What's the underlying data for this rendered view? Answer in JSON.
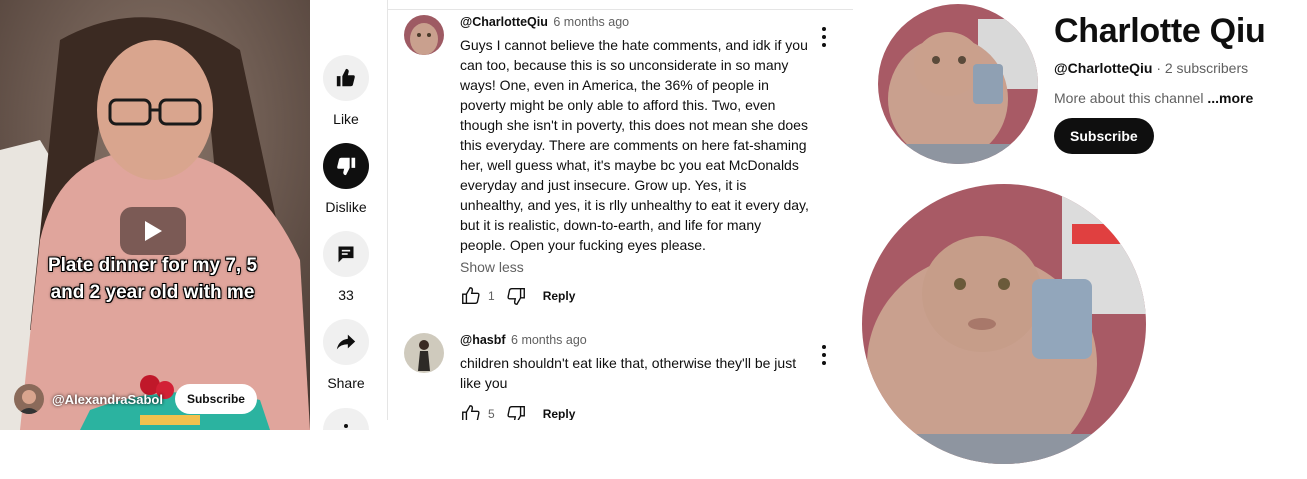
{
  "video": {
    "caption_line1": "Plate dinner for my 7, 5",
    "caption_line2": "and 2 year old with me",
    "channel_handle": "@AlexandraSabol",
    "subscribe_label": "Subscribe"
  },
  "actions": {
    "like_label": "Like",
    "dislike_label": "Dislike",
    "comments_count": "33",
    "share_label": "Share"
  },
  "comments": [
    {
      "author": "@CharlotteQiu",
      "time": "6 months ago",
      "text": "Guys I cannot believe the hate comments, and idk if you can too, because this is so unconsiderate in so many ways! One, even in America, the 36% of people in poverty might be only able to afford this. Two, even though she isn't in poverty, this does not mean she does this everyday. There are comments on here fat-shaming her, well guess what, it's maybe bc you eat McDonalds everyday and just insecure. Grow up. Yes, it is unhealthy, and yes, it is rlly unhealthy to eat it every day, but it is realistic, down-to-earth, and life for many people. Open your fucking eyes please.",
      "show_less": "Show less",
      "likes": "1",
      "reply": "Reply"
    },
    {
      "author": "@hasbf",
      "time": "6 months ago",
      "text": "children shouldn't eat like that, otherwise they'll be just like you",
      "likes": "5",
      "reply": "Reply"
    }
  ],
  "channel_card": {
    "name": "Charlotte Qiu",
    "handle": "@CharlotteQiu",
    "subscribers": "· 2 subscribers",
    "about": "More about this channel ",
    "about_more": "...more",
    "subscribe_label": "Subscribe"
  },
  "colors": {
    "text_primary": "#0f0f0f",
    "text_secondary": "#606060",
    "button_bg": "#f0f0f0",
    "accent_dark": "#0f0f0f"
  }
}
